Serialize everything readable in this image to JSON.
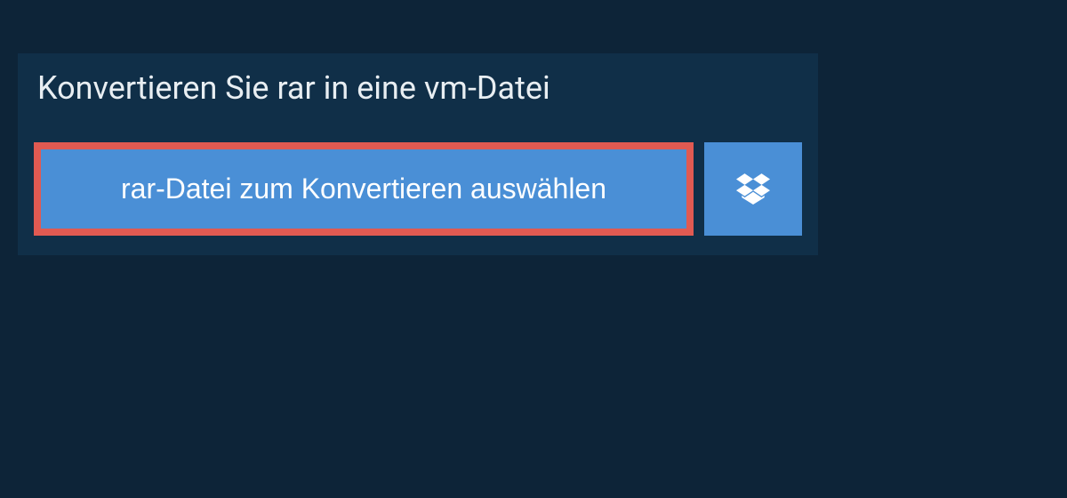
{
  "header": {
    "title": "Konvertieren Sie rar in eine vm-Datei"
  },
  "actions": {
    "select_file_label": "rar-Datei zum Konvertieren auswählen",
    "dropbox_icon": "dropbox-icon"
  },
  "colors": {
    "background": "#0d2438",
    "panel": "#102f48",
    "button": "#4a8fd6",
    "highlight_border": "#e05a52",
    "text": "#e8eef2"
  }
}
